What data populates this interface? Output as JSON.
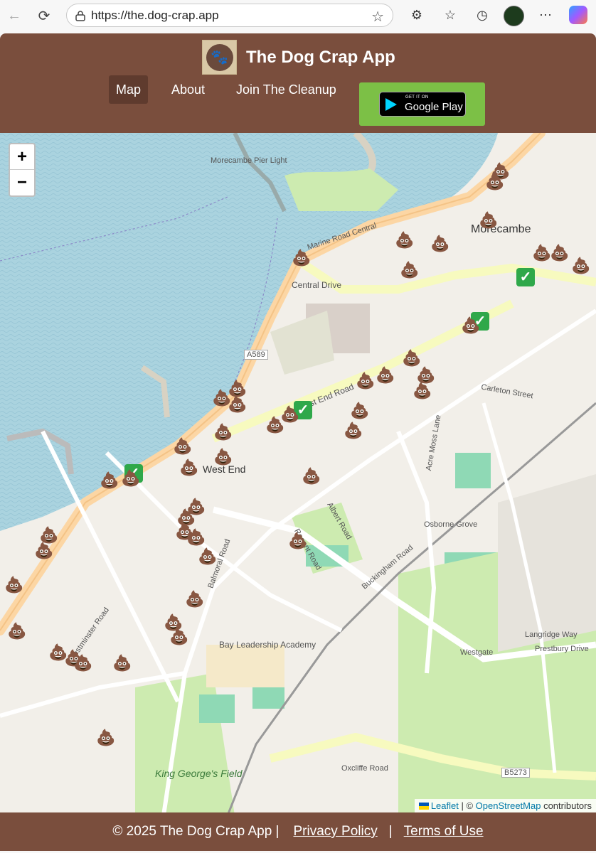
{
  "browser": {
    "url": "https://the.dog-crap.app"
  },
  "header": {
    "title": "The Dog Crap App",
    "logo_glyph": "🐾",
    "nav": [
      {
        "label": "Map",
        "active": true
      },
      {
        "label": "About",
        "active": false
      },
      {
        "label": "Join The Cleanup",
        "active": false
      }
    ],
    "play_badge": {
      "small": "GET IT ON",
      "big": "Google Play"
    }
  },
  "map": {
    "zoom_in": "+",
    "zoom_out": "−",
    "places": [
      "Morecambe",
      "Morecambe Pier Light",
      "West End",
      "King George's Field",
      "Bay Leadership Academy",
      "Langridge Way"
    ],
    "roads": [
      "Marine Road Central",
      "Central Drive",
      "West End Road",
      "A589",
      "Westgate",
      "Oxcliffe Road",
      "Balmoral Road",
      "Regent Road",
      "Albert Road",
      "Westminster Road",
      "Buckingham Road",
      "Acre Moss Lane",
      "Osborne Grove",
      "Carleton Street",
      "Prestbury Drive",
      "B5273"
    ],
    "poo_marker": "💩",
    "check_marker": "✓",
    "attribution": {
      "leaflet": "Leaflet",
      "sep": " | © ",
      "osm": "OpenStreetMap",
      "suffix": " contributors"
    }
  },
  "footer": {
    "copyright": "© 2025 The Dog Crap App |",
    "privacy": "Privacy Policy",
    "divider": "|",
    "terms": "Terms of Use"
  }
}
